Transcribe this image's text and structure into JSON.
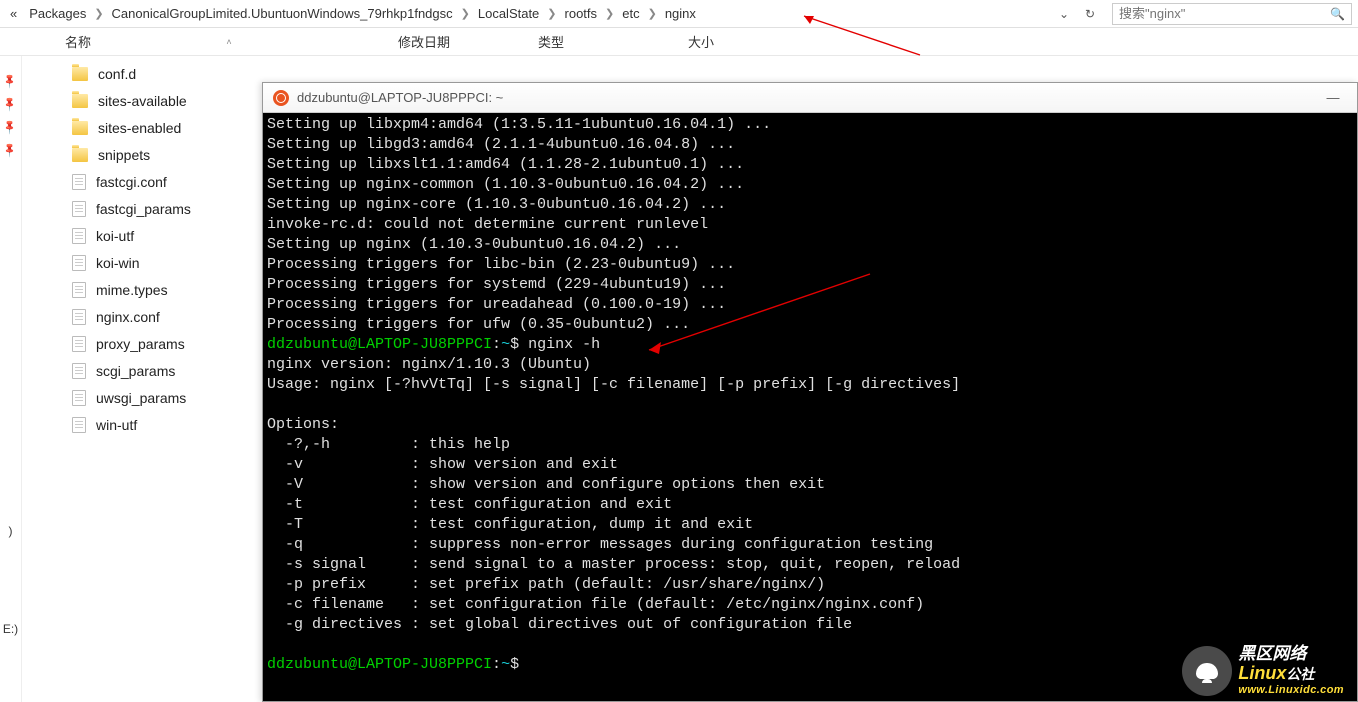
{
  "breadcrumb": {
    "items": [
      "Packages",
      "CanonicalGroupLimited.UbuntuonWindows_79rhkp1fndgsc",
      "LocalState",
      "rootfs",
      "etc",
      "nginx"
    ],
    "prefix": "«"
  },
  "search": {
    "placeholder": "搜索\"nginx\""
  },
  "columns": {
    "name": "名称",
    "modified": "修改日期",
    "type": "类型",
    "size": "大小"
  },
  "pin_drives": [
    ")",
    "E:)"
  ],
  "files": [
    {
      "name": "conf.d",
      "kind": "folder"
    },
    {
      "name": "sites-available",
      "kind": "folder"
    },
    {
      "name": "sites-enabled",
      "kind": "folder"
    },
    {
      "name": "snippets",
      "kind": "folder"
    },
    {
      "name": "fastcgi.conf",
      "kind": "file"
    },
    {
      "name": "fastcgi_params",
      "kind": "file"
    },
    {
      "name": "koi-utf",
      "kind": "file"
    },
    {
      "name": "koi-win",
      "kind": "file"
    },
    {
      "name": "mime.types",
      "kind": "file"
    },
    {
      "name": "nginx.conf",
      "kind": "file"
    },
    {
      "name": "proxy_params",
      "kind": "file"
    },
    {
      "name": "scgi_params",
      "kind": "file"
    },
    {
      "name": "uwsgi_params",
      "kind": "file"
    },
    {
      "name": "win-utf",
      "kind": "file"
    }
  ],
  "terminal": {
    "title": "ddzubuntu@LAPTOP-JU8PPPCI: ~",
    "prompt_user": "ddzubuntu@LAPTOP-JU8PPPCI",
    "prompt_path": "~",
    "cmd": "nginx -h",
    "lines": [
      "Setting up libxpm4:amd64 (1:3.5.11-1ubuntu0.16.04.1) ...",
      "Setting up libgd3:amd64 (2.1.1-4ubuntu0.16.04.8) ...",
      "Setting up libxslt1.1:amd64 (1.1.28-2.1ubuntu0.1) ...",
      "Setting up nginx-common (1.10.3-0ubuntu0.16.04.2) ...",
      "Setting up nginx-core (1.10.3-0ubuntu0.16.04.2) ...",
      "invoke-rc.d: could not determine current runlevel",
      "Setting up nginx (1.10.3-0ubuntu0.16.04.2) ...",
      "Processing triggers for libc-bin (2.23-0ubuntu9) ...",
      "Processing triggers for systemd (229-4ubuntu19) ...",
      "Processing triggers for ureadahead (0.100.0-19) ...",
      "Processing triggers for ufw (0.35-0ubuntu2) ..."
    ],
    "out": [
      "nginx version: nginx/1.10.3 (Ubuntu)",
      "Usage: nginx [-?hvVtTq] [-s signal] [-c filename] [-p prefix] [-g directives]",
      "",
      "Options:",
      "  -?,-h         : this help",
      "  -v            : show version and exit",
      "  -V            : show version and configure options then exit",
      "  -t            : test configuration and exit",
      "  -T            : test configuration, dump it and exit",
      "  -q            : suppress non-error messages during configuration testing",
      "  -s signal     : send signal to a master process: stop, quit, reopen, reload",
      "  -p prefix     : set prefix path (default: /usr/share/nginx/)",
      "  -c filename   : set configuration file (default: /etc/nginx/nginx.conf)",
      "  -g directives : set global directives out of configuration file",
      ""
    ]
  },
  "watermark": {
    "label_top": "黑区网络",
    "brand": "Linux",
    "suffix": "公社",
    "site": "www.Linuxidc.com"
  }
}
